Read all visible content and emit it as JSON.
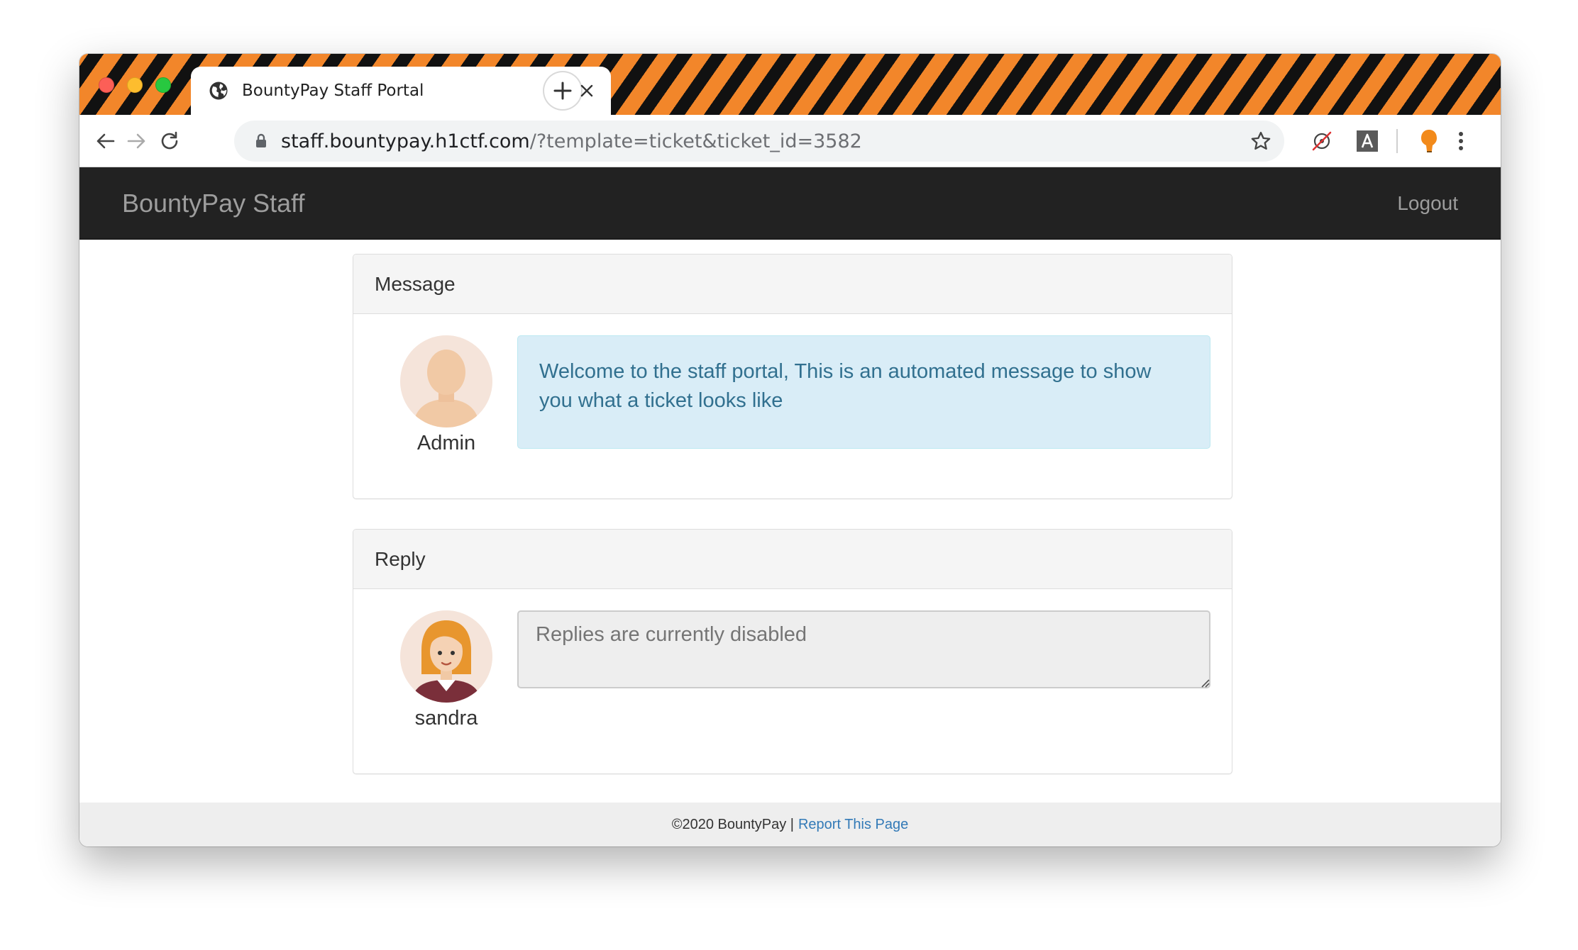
{
  "browser": {
    "tab_title": "BountyPay Staff Portal",
    "url_host": "staff.bountypay.h1ctf.com",
    "url_path": "/?template=ticket&ticket_id=3582"
  },
  "navbar": {
    "brand": "BountyPay Staff",
    "logout": "Logout"
  },
  "message_panel": {
    "heading": "Message",
    "author": "Admin",
    "text": "Welcome to the staff portal, This is an automated message to show you what a ticket looks like"
  },
  "reply_panel": {
    "heading": "Reply",
    "author": "sandra",
    "placeholder": "Replies are currently disabled"
  },
  "footer": {
    "copyright": "©2020 BountyPay |",
    "report_link": "Report This Page"
  },
  "icons": [
    "globe-icon",
    "close-icon",
    "plus-icon",
    "back-arrow-icon",
    "forward-arrow-icon",
    "reload-icon",
    "lock-icon",
    "star-icon",
    "tracker-blocked-icon",
    "font-a-icon",
    "extension-icon",
    "kebab-menu-icon"
  ],
  "colors": {
    "stripe_orange": "#f2862a",
    "stripe_black": "#111111",
    "navbar_bg": "#222222",
    "alert_bg": "#d9edf7",
    "alert_text": "#31708f",
    "link": "#337ab7"
  }
}
